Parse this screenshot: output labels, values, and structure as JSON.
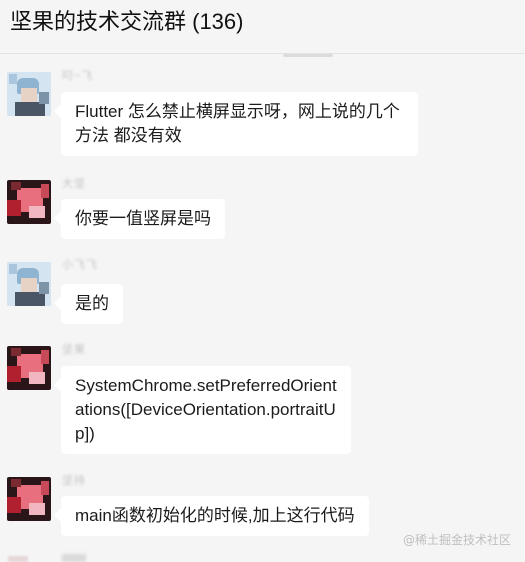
{
  "header": {
    "title": "坚果的技术交流群 (136)"
  },
  "messages": [
    {
      "nickname": "叼~飞",
      "text": "Flutter 怎么禁止横屏显示呀，网上说的几个方法 都没有效"
    },
    {
      "nickname": "大坚",
      "text": "你要一值竖屏是吗"
    },
    {
      "nickname": "小飞飞",
      "text": "是的"
    },
    {
      "nickname": "坚果",
      "text": "SystemChrome.setPreferredOrientations([DeviceOrientation.portraitUp])"
    },
    {
      "nickname": "坚持",
      "text": "main函数初始化的时候,加上这行代码"
    }
  ],
  "watermark": "@稀土掘金技术社区",
  "colors": {
    "background": "#f5f5f5",
    "bubble": "#ffffff",
    "text": "#1b1b1b"
  }
}
